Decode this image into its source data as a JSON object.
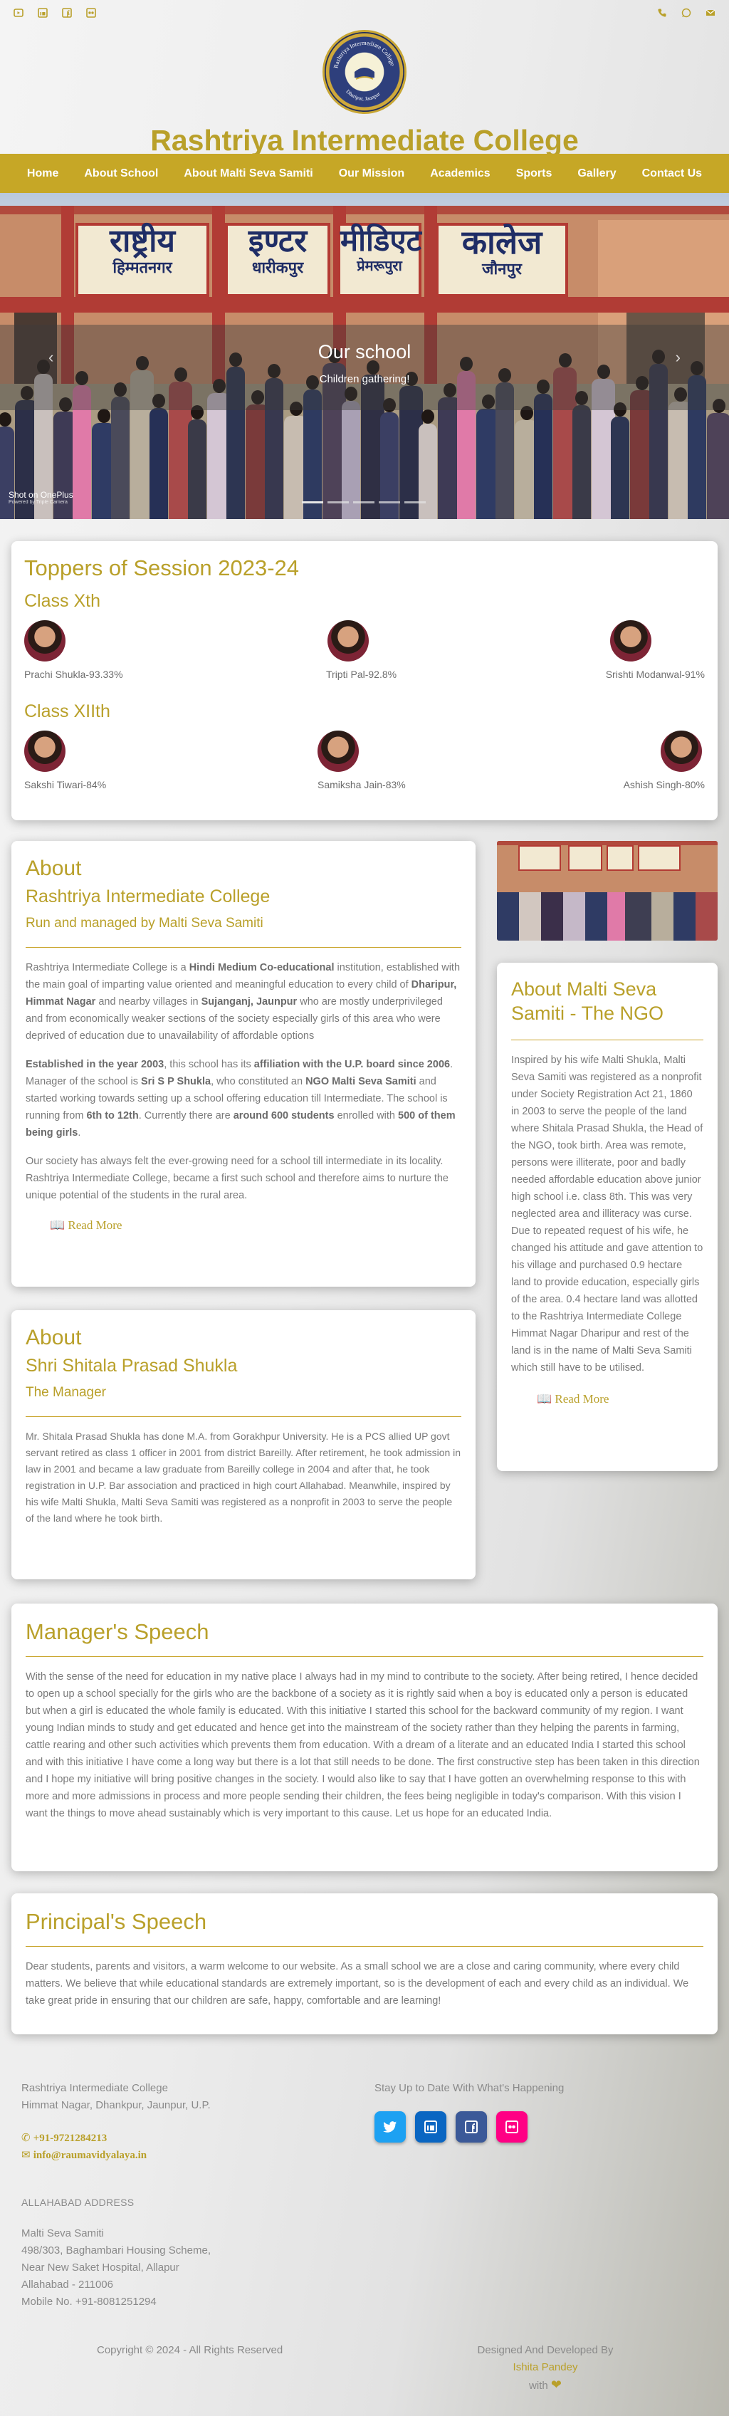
{
  "topbar": {
    "left_icons": [
      "youtube-icon",
      "linkedin-icon",
      "facebook-icon",
      "flickr-icon"
    ],
    "right_icons": [
      "phone-icon",
      "whatsapp-icon",
      "email-icon"
    ]
  },
  "header": {
    "logo_text": "Rashtriya Intermediate College",
    "logo_sub": "Dharipur, Jaunpur",
    "title": "Rashtriya Intermediate College"
  },
  "nav": [
    "Home",
    "About School",
    "About Malti Seva Samiti",
    "Our Mission",
    "Academics",
    "Sports",
    "Gallery",
    "Contact Us"
  ],
  "hero": {
    "board_texts": [
      "राष्ट्रीय",
      "इण्टर",
      "मीडिएट",
      "कालेज"
    ],
    "board_subs": [
      "हिम्मतनगर",
      "धारीकपुर",
      "प्रेमरूपुरा",
      "जौनपुर"
    ],
    "caption_title": "Our school",
    "caption_sub": "Children gathering!",
    "shot_label": "Shot on OnePlus",
    "shot_sub": "Powered by Triple Camera",
    "slides": 5
  },
  "toppers": {
    "title": "Toppers of Session 2023-24",
    "class10": "Class Xth",
    "class12": "Class XIIth",
    "x": [
      {
        "name": "Prachi Shukla-93.33%"
      },
      {
        "name": "Tripti Pal-92.8%"
      },
      {
        "name": "Srishti Modanwal-91%"
      }
    ],
    "xii": [
      {
        "name": "Sakshi Tiwari-84%"
      },
      {
        "name": "Samiksha Jain-83%"
      },
      {
        "name": "Ashish Singh-80%"
      }
    ]
  },
  "about_school": {
    "heading": "About",
    "subheading": "Rashtriya Intermediate College",
    "tag": "Run and managed by Malti Seva Samiti",
    "readmore": "Read More"
  },
  "about_ngo": {
    "heading": "About Malti Seva Samiti - The NGO",
    "body": "Inspired by his wife Malti Shukla, Malti Seva Samiti was registered as a nonprofit under Society Registration Act 21, 1860 in 2003 to serve the people of the land where Shitala Prasad Shukla, the Head of the NGO, took birth. Area was remote, persons were illiterate, poor and badly needed affordable education above junior high school i.e. class 8th. This was very neglected area and illiteracy was curse. Due to repeated request of his wife, he changed his attitude and gave attention to his village and purchased 0.9 hectare land to provide education, especially girls of the area. 0.4 hectare land was allotted to the Rashtriya Intermediate College Himmat Nagar Dharipur and rest of the land is in the name of Malti Seva Samiti which still have to be utilised.",
    "readmore": "Read More"
  },
  "about_manager": {
    "heading": "About",
    "subheading": "Shri Shitala Prasad Shukla",
    "tag": "The Manager",
    "body": "Mr. Shitala Prasad Shukla has done M.A. from Gorakhpur University. He is a PCS allied UP govt servant retired as class 1 officer in 2001 from district Bareilly. After retirement, he took admission in law in 2001 and became a law graduate from Bareilly college in 2004 and after that, he took registration in U.P. Bar association and practiced in high court Allahabad. Meanwhile, inspired by his wife Malti Shukla, Malti Seva Samiti was registered as a nonprofit in 2003 to serve the people of the land where he took birth."
  },
  "manager_speech": {
    "title": "Manager's Speech",
    "body": "With the sense of the need for education in my native place I always had in my mind to contribute to the society. After being retired, I hence decided to open up a school specially for the girls who are the backbone of a society as it is rightly said when a boy is educated only a person is educated but when a girl is educated the whole family is educated. With this initiative I started this school for the backward community of my region. I want young Indian minds to study and get educated and hence get into the mainstream of the society rather than they helping the parents in farming, cattle rearing and other such activities which prevents them from education. With a dream of a literate and an educated India I started this school and with this initiative I have come a long way but there is a lot that still needs to be done. The first constructive step has been taken in this direction and I hope my initiative will bring positive changes in the society. I would also like to say that I have gotten an overwhelming response to this with more and more admissions in process and more people sending their children, the fees being negligible in today's comparison. With this vision I want the things to move ahead sustainably which is very important to this cause. Let us hope for an educated India."
  },
  "principal_speech": {
    "title": "Principal's Speech",
    "body": "Dear students, parents and visitors, a warm welcome to our website. As a small school we are a close and caring community, where every child matters. We believe that while educational standards are extremely important, so is the development of each and every child as an individual. We take great pride in ensuring that our children are safe, happy, comfortable and are learning!"
  },
  "footer": {
    "name": "Rashtriya Intermediate College",
    "address": "Himmat Nagar, Dhankpur, Jaunpur, U.P.",
    "phone": "+91-9721284213",
    "email": "info@raumavidyalaya.in",
    "stay": "Stay Up to Date With What's Happening",
    "alld_title": "ALLAHABAD ADDRESS",
    "alld_lines": [
      "Malti Seva Samiti",
      "498/303, Baghambari Housing Scheme,",
      "Near New Saket Hospital, Allapur",
      "Allahabad - 211006",
      "Mobile No. +91-8081251294"
    ],
    "copyright": "Copyright © 2024 - All Rights Reserved",
    "designed": "Designed And Developed By",
    "designer": "Ishita Pandey",
    "with": "with",
    "social": [
      {
        "name": "twitter",
        "color": "#1da1f2",
        "glyph": "t"
      },
      {
        "name": "linkedin",
        "color": "#0a66c2",
        "glyph": "in"
      },
      {
        "name": "facebook",
        "color": "#3b5998",
        "glyph": "f"
      },
      {
        "name": "flickr",
        "color": "#ff0084",
        "glyph": "••"
      }
    ]
  }
}
